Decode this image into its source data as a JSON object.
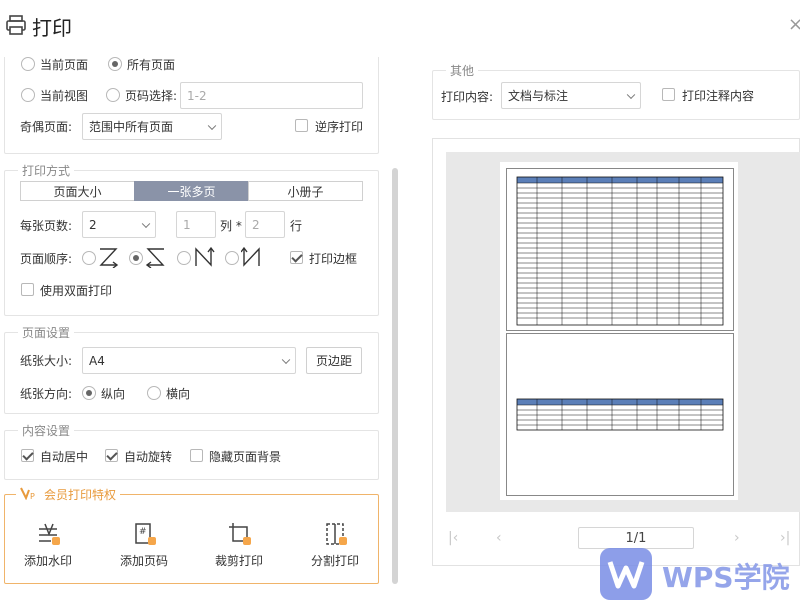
{
  "dialog": {
    "title": "打印",
    "close_glyph": "×"
  },
  "page_range": {
    "current_page": "当前页面",
    "all_pages": "所有页面",
    "current_view": "当前视图",
    "page_select": "页码选择:",
    "page_select_placeholder": "1-2",
    "odd_even_label": "奇偶页面:",
    "odd_even_value": "范围中所有页面",
    "reverse_print": "逆序打印"
  },
  "print_mode": {
    "legend": "打印方式",
    "tabs": [
      "页面大小",
      "一张多页",
      "小册子"
    ],
    "active_tab": 1,
    "per_sheet_label": "每张页数:",
    "per_sheet_value": "2",
    "cols_value": "1",
    "cols_unit": "列 *",
    "rows_value": "2",
    "rows_unit": "行",
    "page_order_label": "页面顺序:",
    "print_border": "打印边框",
    "duplex": "使用双面打印"
  },
  "page_setup": {
    "legend": "页面设置",
    "paper_size_label": "纸张大小:",
    "paper_size_value": "A4",
    "margins_button": "页边距",
    "orientation_label": "纸张方向:",
    "portrait": "纵向",
    "landscape": "横向"
  },
  "content_setup": {
    "legend": "内容设置",
    "auto_center": "自动居中",
    "auto_rotate": "自动旋转",
    "hide_background": "隐藏页面背景"
  },
  "vip": {
    "legend": "会员打印特权",
    "items": [
      "添加水印",
      "添加页码",
      "裁剪打印",
      "分割打印"
    ]
  },
  "other": {
    "legend": "其他",
    "print_content_label": "打印内容:",
    "print_content_value": "文档与标注",
    "print_comments": "打印注释内容"
  },
  "preview": {
    "page_indicator": "1/1"
  },
  "watermark": {
    "text": "WPS学院"
  },
  "colors": {
    "accent_vip": "#f0b46a",
    "tab_active": "#8a93a8",
    "table_header": "#5b7fb8"
  }
}
